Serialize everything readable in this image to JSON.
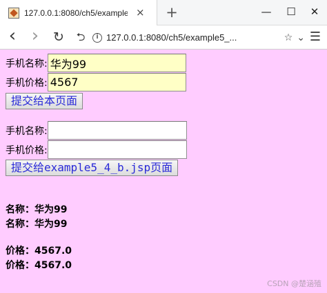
{
  "browser": {
    "tab_title": "127.0.0.1:8080/ch5/example5_",
    "url": "127.0.0.1:8080/ch5/example5_...",
    "icons": {
      "favicon": "page-favicon",
      "tab_close": "×",
      "new_tab": "+",
      "minimize": "—",
      "maximize": "☐",
      "close": "✕",
      "back": "‹",
      "forward": "›",
      "reload": "↻",
      "home": "⮌",
      "info": "i",
      "star": "☆",
      "dropdown": "⌄",
      "menu": "☰"
    }
  },
  "form1": {
    "name_label": "手机名称:",
    "name_value": "华为99",
    "price_label": "手机价格:",
    "price_value": "4567",
    "submit_label": "提交给本页面"
  },
  "form2": {
    "name_label": "手机名称:",
    "name_value": "",
    "price_label": "手机价格:",
    "price_value": "",
    "submit_label": "提交给example5_4_b.jsp页面"
  },
  "results": {
    "name_line_1": "名称：华为99",
    "name_line_2": "名称：华为99",
    "price_line_1": "价格：4567.0",
    "price_line_2": "价格：4567.0"
  },
  "watermark": "CSDN @楚涵殖",
  "colors": {
    "page_bg": "#ffccff",
    "filled_field_bg": "#ffffc6",
    "button_text": "#2a2ad8"
  }
}
